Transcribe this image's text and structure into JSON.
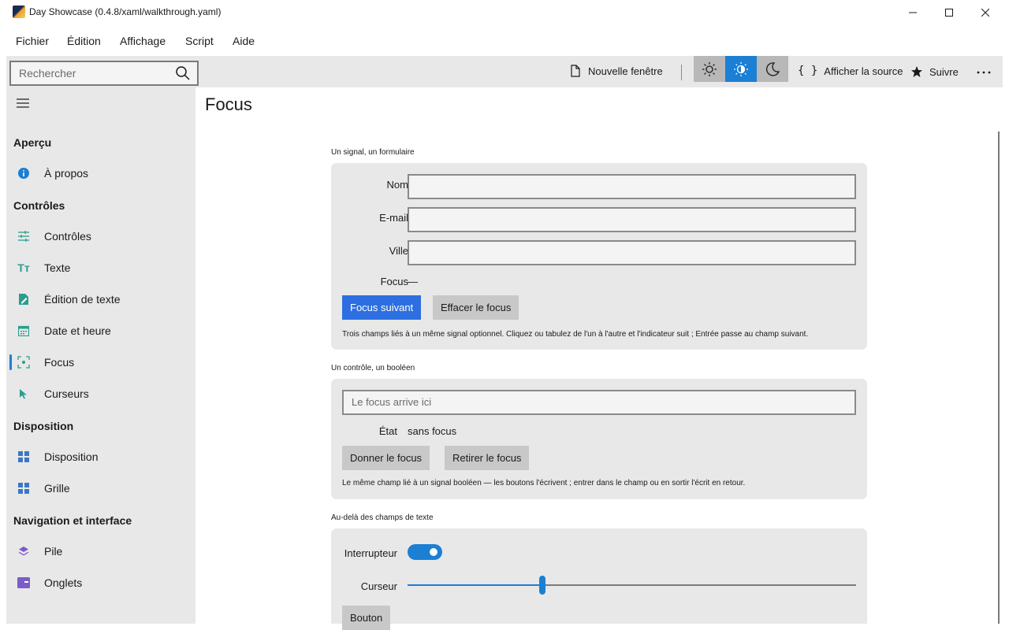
{
  "window": {
    "title": "Day Showcase (0.4.8/xaml/walkthrough.yaml)",
    "icons": {
      "minimize": "minimize-icon",
      "maximize": "maximize-icon",
      "close": "close-icon"
    }
  },
  "menu": [
    "Fichier",
    "Édition",
    "Affichage",
    "Script",
    "Aide"
  ],
  "toolbar": {
    "search_placeholder": "Rechercher",
    "new_window": "Nouvelle fenêtre",
    "view_source": "Afficher la source",
    "follow": "Suivre",
    "theme_selected": "auto"
  },
  "sidebar": {
    "sections": [
      {
        "title": "Aperçu",
        "items": [
          {
            "label": "À propos",
            "icon": "info-icon"
          }
        ]
      },
      {
        "title": "Contrôles",
        "items": [
          {
            "label": "Contrôles",
            "icon": "sliders-icon"
          },
          {
            "label": "Texte",
            "icon": "text-icon"
          },
          {
            "label": "Édition de texte",
            "icon": "edit-text-icon"
          },
          {
            "label": "Date et heure",
            "icon": "calendar-icon"
          },
          {
            "label": "Focus",
            "icon": "focus-icon",
            "selected": true
          },
          {
            "label": "Curseurs",
            "icon": "cursor-icon"
          }
        ]
      },
      {
        "title": "Disposition",
        "items": [
          {
            "label": "Disposition",
            "icon": "layout-icon"
          },
          {
            "label": "Grille",
            "icon": "grid-icon"
          }
        ]
      },
      {
        "title": "Navigation et interface",
        "items": [
          {
            "label": "Pile",
            "icon": "stack-icon"
          },
          {
            "label": "Onglets",
            "icon": "tabs-icon"
          }
        ]
      }
    ]
  },
  "page": {
    "title": "Focus",
    "form": {
      "heading": "Un signal, un formulaire",
      "name_label": "Nom",
      "email_label": "E-mail",
      "city_label": "Ville",
      "focus_label": "Focus",
      "focus_value": "—",
      "next_button": "Focus suivant",
      "clear_button": "Effacer le focus",
      "help": "Trois champs liés à un même signal optionnel. Cliquez ou tabulez de l'un à l'autre et l'indicateur suit ; Entrée passe au champ suivant."
    },
    "boolean": {
      "heading": "Un contrôle, un booléen",
      "placeholder": "Le focus arrive ici",
      "state_label": "État",
      "state_value": "sans focus",
      "give_button": "Donner le focus",
      "remove_button": "Retirer le focus",
      "help": "Le même champ lié à un signal booléen — les boutons l'écrivent ; entrer dans le champ ou en sortir l'écrit en retour."
    },
    "beyond": {
      "heading": "Au-delà des champs de texte",
      "switch_label": "Interrupteur",
      "switch_on": true,
      "slider_label": "Curseur",
      "slider_value": 0.3,
      "button_label": "Bouton"
    }
  },
  "colors": {
    "accent": "#1b7fd4",
    "primary_button": "#2d6fe0",
    "panel": "#e8e8e8"
  }
}
